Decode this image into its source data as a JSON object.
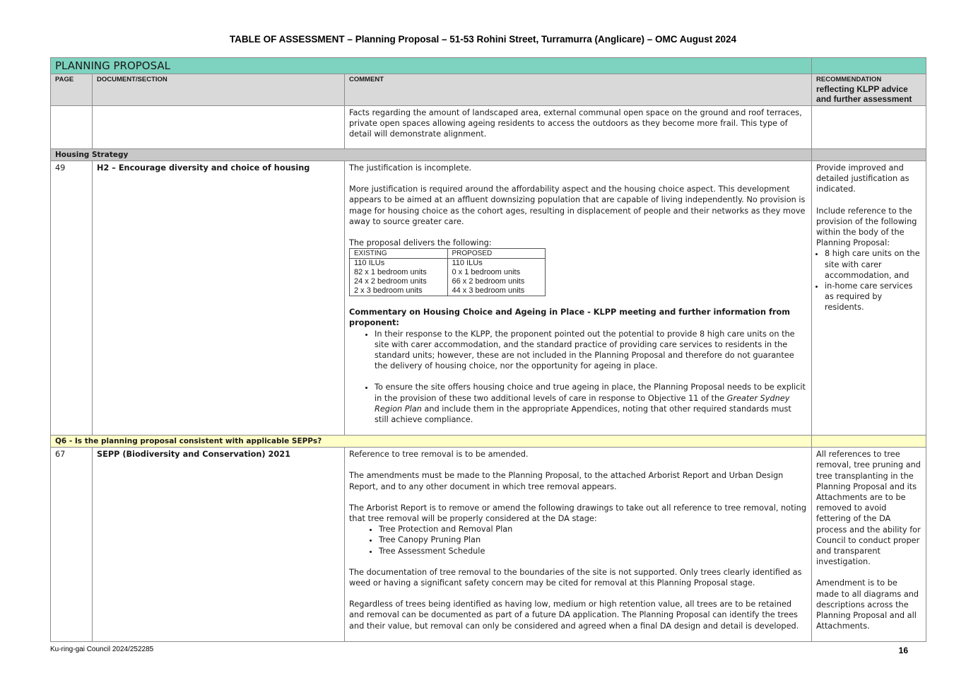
{
  "document": {
    "title": "TABLE OF ASSESSMENT – Planning Proposal – 51-53 Rohini Street, Turramurra (Anglicare) – OMC August 2024",
    "footer_left": "Ku-ring-gai Council 2024/252285",
    "page_number": "16"
  },
  "table": {
    "section_title": "PLANNING PROPOSAL",
    "headers": {
      "page": "PAGE",
      "document_section": "DOCUMENT/SECTION",
      "comment": "COMMENT",
      "recommendation": "RECOMMENDATION",
      "recommendation_sub": "reflecting KLPP advice and further assessment"
    },
    "row_continued": {
      "comment": "Facts regarding the amount of landscaped area, external communal open space on the ground and roof terraces, private open spaces allowing ageing residents to access the outdoors as they become more frail. This type of detail will demonstrate alignment."
    },
    "housing_strategy": {
      "heading": "Housing Strategy",
      "page": "49",
      "section": "H2 – Encourage diversity and choice of housing",
      "comment_p1": "The justification is incomplete.",
      "comment_p2": "More justification is required around the affordability aspect and the housing choice aspect. This development appears to be aimed at an affluent downsizing population that are capable of living independently. No provision is mage for housing choice as the cohort ages, resulting in displacement of people and their networks as they move away to source greater care.",
      "comment_p3": "The proposal delivers the following:",
      "units_table": {
        "headers": [
          "EXISTING",
          "PROPOSED"
        ],
        "rows": [
          [
            "110 ILUs",
            "110 ILUs"
          ],
          [
            "82 x 1 bedroom units",
            "0 x 1 bedroom units"
          ],
          [
            "24 x 2 bedroom units",
            "66 x 2 bedroom units"
          ],
          [
            "2 x 3 bedroom units",
            "44 x 3 bedroom units"
          ]
        ]
      },
      "commentary_heading": "Commentary on Housing Choice and Ageing in Place - KLPP meeting and further information from proponent:",
      "bullet1": "In their response to the KLPP, the proponent pointed out the potential to provide 8 high care units on the site with carer accommodation, and the standard practice of providing care services to residents in the standard units; however, these are not included in the Planning Proposal and therefore do not guarantee the delivery of housing choice, nor the opportunity for ageing in place.",
      "bullet2_a": "To ensure the site offers housing choice and true ageing in place, the Planning Proposal needs to be explicit in the provision of these two additional levels of care in response to Objective 11 of the ",
      "bullet2_italic": "Greater Sydney Region Plan",
      "bullet2_b": " and include them in the appropriate Appendices, noting that other required standards must still achieve compliance.",
      "rec_p1": "Provide improved and detailed justification as indicated.",
      "rec_p2": "Include reference to the provision of the following within the body of the Planning Proposal:",
      "rec_bullets": [
        "8 high care units on the site with carer accommodation, and",
        "in-home care services as required by residents."
      ]
    },
    "q6": {
      "heading": "Q6 - Is the planning proposal consistent with applicable SEPPs?",
      "page": "67",
      "section": "SEPP (Biodiversity and Conservation) 2021",
      "comment_p1": "Reference to tree removal is to be amended.",
      "comment_p2": "The amendments must be made to the Planning Proposal, to the attached Arborist Report and Urban Design Report, and to any other document in which tree removal appears.",
      "comment_p3": "The Arborist Report is to remove or amend the following drawings to take out all reference to tree removal, noting that tree removal will be properly considered at the DA stage:",
      "drawings": [
        "Tree Protection and Removal Plan",
        "Tree Canopy Pruning Plan",
        "Tree Assessment Schedule"
      ],
      "comment_p4": "The documentation of tree removal to the boundaries of the site is not supported. Only trees clearly identified as weed or having a significant safety concern may be cited for removal at this Planning Proposal stage.",
      "comment_p5": "Regardless of trees being identified as having low, medium or high retention value, all trees are to be retained and removal can be documented as part of a future DA application. The Planning Proposal can identify the trees and their value, but removal can only be considered and agreed when a final DA design and detail is developed.",
      "rec_p1": "All references to tree removal, tree pruning and tree transplanting in the Planning Proposal and its Attachments are to be removed to avoid fettering of the DA process and the ability for Council to conduct proper and transparent investigation.",
      "rec_p2": "Amendment is to be made to all diagrams and descriptions across the Planning Proposal and all Attachments."
    }
  },
  "colors": {
    "section_header_bg": "#7dd3bf",
    "column_header_bg": "#d9d9d9",
    "housing_strategy_bg": "#c8c8c8",
    "q6_bg": "#ffffc8",
    "border": "#8c8c8c"
  }
}
